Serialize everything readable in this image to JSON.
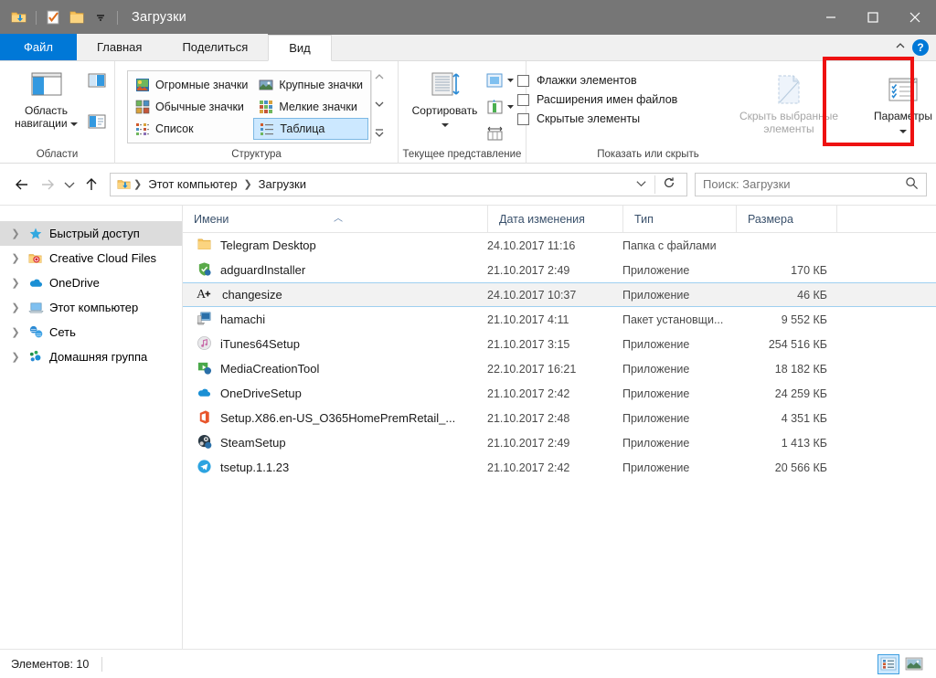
{
  "window": {
    "title": "Загрузки",
    "quick_access": [
      "downloads-folder-icon",
      "properties-icon",
      "new-folder-icon",
      "customize-qat-chevron"
    ],
    "controls": {
      "minimize": "—",
      "maximize": "□",
      "close": "✕"
    }
  },
  "tabs": {
    "file": "Файл",
    "items": [
      {
        "label": "Главная",
        "active": false
      },
      {
        "label": "Поделиться",
        "active": false
      },
      {
        "label": "Вид",
        "active": true
      }
    ],
    "collapse_icon": "chevron-up-icon",
    "help_label": "?"
  },
  "ribbon": {
    "groups": [
      {
        "label": "Области",
        "big_button": {
          "line1": "Область",
          "line2": "навигации",
          "has_caret": true
        },
        "small_buttons": [
          "preview-pane-icon",
          "details-pane-icon"
        ]
      },
      {
        "label": "Структура",
        "layout_items": [
          {
            "label": "Огромные значки",
            "selected": false
          },
          {
            "label": "Крупные значки",
            "selected": false
          },
          {
            "label": "Обычные значки",
            "selected": false
          },
          {
            "label": "Мелкие значки",
            "selected": false
          },
          {
            "label": "Список",
            "selected": false
          },
          {
            "label": "Таблица",
            "selected": true
          }
        ]
      },
      {
        "label": "Текущее представление",
        "big_button": {
          "line1": "Сортировать",
          "line2": "",
          "has_caret": true
        },
        "small_buttons": [
          "add-columns-icon",
          "column-size-icon",
          "size-all-columns-icon"
        ]
      },
      {
        "label": "Показать или скрыть",
        "checkboxes": [
          {
            "label": "Флажки элементов",
            "checked": false
          },
          {
            "label": "Расширения имен файлов",
            "checked": false
          },
          {
            "label": "Скрытые элементы",
            "checked": false
          }
        ],
        "hide_selected": {
          "line1": "Скрыть выбранные",
          "line2": "элементы",
          "disabled": true
        },
        "options_button": {
          "label": "Параметры",
          "has_caret": true,
          "highlighted": true
        }
      }
    ],
    "highlight_color": "#ee1111"
  },
  "address": {
    "back_icon": "back-arrow-icon",
    "forward_icon": "forward-arrow-icon",
    "recent_icon": "chevron-down-icon",
    "up_icon": "up-arrow-icon",
    "breadcrumb_icon": "downloads-folder-icon",
    "breadcrumbs": [
      "Этот компьютер",
      "Загрузки"
    ],
    "dropdown_icon": "chevron-down-icon",
    "refresh_icon": "refresh-icon",
    "search_placeholder": "Поиск: Загрузки",
    "search_icon": "search-icon"
  },
  "sidebar": {
    "items": [
      {
        "label": "Быстрый доступ",
        "icon": "star-icon",
        "selected": true
      },
      {
        "label": "Creative Cloud Files",
        "icon": "creative-cloud-folder-icon",
        "selected": false
      },
      {
        "label": "OneDrive",
        "icon": "onedrive-cloud-icon",
        "selected": false
      },
      {
        "label": "Этот компьютер",
        "icon": "computer-icon",
        "selected": false
      },
      {
        "label": "Сеть",
        "icon": "network-icon",
        "selected": false
      },
      {
        "label": "Домашняя группа",
        "icon": "homegroup-icon",
        "selected": false
      }
    ]
  },
  "filelist": {
    "columns": [
      {
        "label": "Имени",
        "sorted": true,
        "sort_dir": "asc"
      },
      {
        "label": "Дата изменения",
        "sorted": false
      },
      {
        "label": "Тип",
        "sorted": false
      },
      {
        "label": "Размера",
        "sorted": false
      }
    ],
    "rows": [
      {
        "name": "Telegram Desktop",
        "date": "24.10.2017 11:16",
        "type": "Папка с файлами",
        "size": "",
        "icon": "folder-icon",
        "selected": false
      },
      {
        "name": "adguardInstaller",
        "date": "21.10.2017 2:49",
        "type": "Приложение",
        "size": "170 КБ",
        "icon": "adguard-shield-icon",
        "selected": false
      },
      {
        "name": "changesize",
        "date": "24.10.2017 10:37",
        "type": "Приложение",
        "size": "46 КБ",
        "icon": "font-size-icon",
        "selected": true
      },
      {
        "name": "hamachi",
        "date": "21.10.2017 4:11",
        "type": "Пакет установщи...",
        "size": "9 552 КБ",
        "icon": "msi-installer-icon",
        "selected": false
      },
      {
        "name": "iTunes64Setup",
        "date": "21.10.2017 3:15",
        "type": "Приложение",
        "size": "254 516 КБ",
        "icon": "itunes-icon",
        "selected": false
      },
      {
        "name": "MediaCreationTool",
        "date": "22.10.2017 16:21",
        "type": "Приложение",
        "size": "18 182 КБ",
        "icon": "media-creation-icon",
        "selected": false
      },
      {
        "name": "OneDriveSetup",
        "date": "21.10.2017 2:42",
        "type": "Приложение",
        "size": "24 259 КБ",
        "icon": "onedrive-cloud-icon",
        "selected": false
      },
      {
        "name": "Setup.X86.en-US_O365HomePremRetail_...",
        "date": "21.10.2017 2:48",
        "type": "Приложение",
        "size": "4 351 КБ",
        "icon": "office-icon",
        "selected": false
      },
      {
        "name": "SteamSetup",
        "date": "21.10.2017 2:49",
        "type": "Приложение",
        "size": "1 413 КБ",
        "icon": "steam-icon",
        "selected": false
      },
      {
        "name": "tsetup.1.1.23",
        "date": "21.10.2017 2:42",
        "type": "Приложение",
        "size": "20 566 КБ",
        "icon": "telegram-icon",
        "selected": false
      }
    ]
  },
  "statusbar": {
    "item_count": "Элементов: 10",
    "view_details_icon": "details-view-icon",
    "view_thumbnails_icon": "thumbnails-view-icon"
  }
}
